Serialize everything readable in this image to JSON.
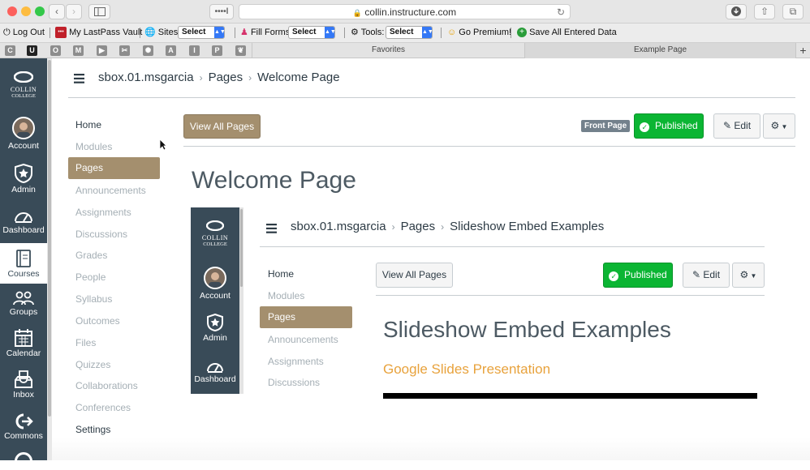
{
  "browser": {
    "url": "collin.instructure.com",
    "dots": "••••l",
    "tabs": [
      "Favorites",
      "Example Page"
    ],
    "new_tab": "+"
  },
  "lastpass": {
    "logout": "Log Out",
    "vault": "My LastPass Vault",
    "sites_label": "Sites:",
    "sites_value": "Select",
    "fill_label": "Fill Forms:",
    "fill_value": "Select",
    "tools_label": "Tools:",
    "tools_value": "Select",
    "premium": "Go Premium!",
    "save_all": "Save All Entered Data"
  },
  "favorites_icons": [
    "C",
    "U",
    "O",
    "M",
    "▶",
    "✂",
    "✺",
    "A",
    "I",
    "P",
    "❦"
  ],
  "global_nav": {
    "logo_top": "COLLIN",
    "logo_bottom": "COLLEGE",
    "items": [
      {
        "label": "Account",
        "icon": "avatar"
      },
      {
        "label": "Admin",
        "icon": "shield-star-icon"
      },
      {
        "label": "Dashboard",
        "icon": "speedometer-icon"
      },
      {
        "label": "Courses",
        "icon": "book-icon"
      },
      {
        "label": "Groups",
        "icon": "people-icon"
      },
      {
        "label": "Calendar",
        "icon": "calendar-icon"
      },
      {
        "label": "Inbox",
        "icon": "inbox-icon"
      },
      {
        "label": "Commons",
        "icon": "commons-icon"
      }
    ]
  },
  "breadcrumb": {
    "course": "sbox.01.msgarcia",
    "section": "Pages",
    "page": "Welcome Page"
  },
  "course_nav": [
    "Home",
    "Modules",
    "Pages",
    "Announcements",
    "Assignments",
    "Discussions",
    "Grades",
    "People",
    "Syllabus",
    "Outcomes",
    "Files",
    "Quizzes",
    "Collaborations",
    "Conferences",
    "Settings"
  ],
  "toolbar": {
    "view_all": "View All Pages",
    "front_badge": "Front Page",
    "published": "Published",
    "edit": "Edit"
  },
  "page_title": "Welcome Page",
  "embed": {
    "logo_top": "COLLIN",
    "logo_bottom": "COLLEGE",
    "nav": [
      "Account",
      "Admin",
      "Dashboard"
    ],
    "breadcrumb": {
      "course": "sbox.01.msgarcia",
      "section": "Pages",
      "page": "Slideshow Embed Examples"
    },
    "course_nav": [
      "Home",
      "Modules",
      "Pages",
      "Announcements",
      "Assignments",
      "Discussions"
    ],
    "view_all": "View All Pages",
    "published": "Published",
    "edit": "Edit",
    "title": "Slideshow Embed Examples",
    "subtitle": "Google Slides Presentation"
  },
  "colors": {
    "global_nav": "#394b58",
    "pages_active": "#a48f6e",
    "published": "#0bb533",
    "link_orange": "#e8a23c"
  }
}
